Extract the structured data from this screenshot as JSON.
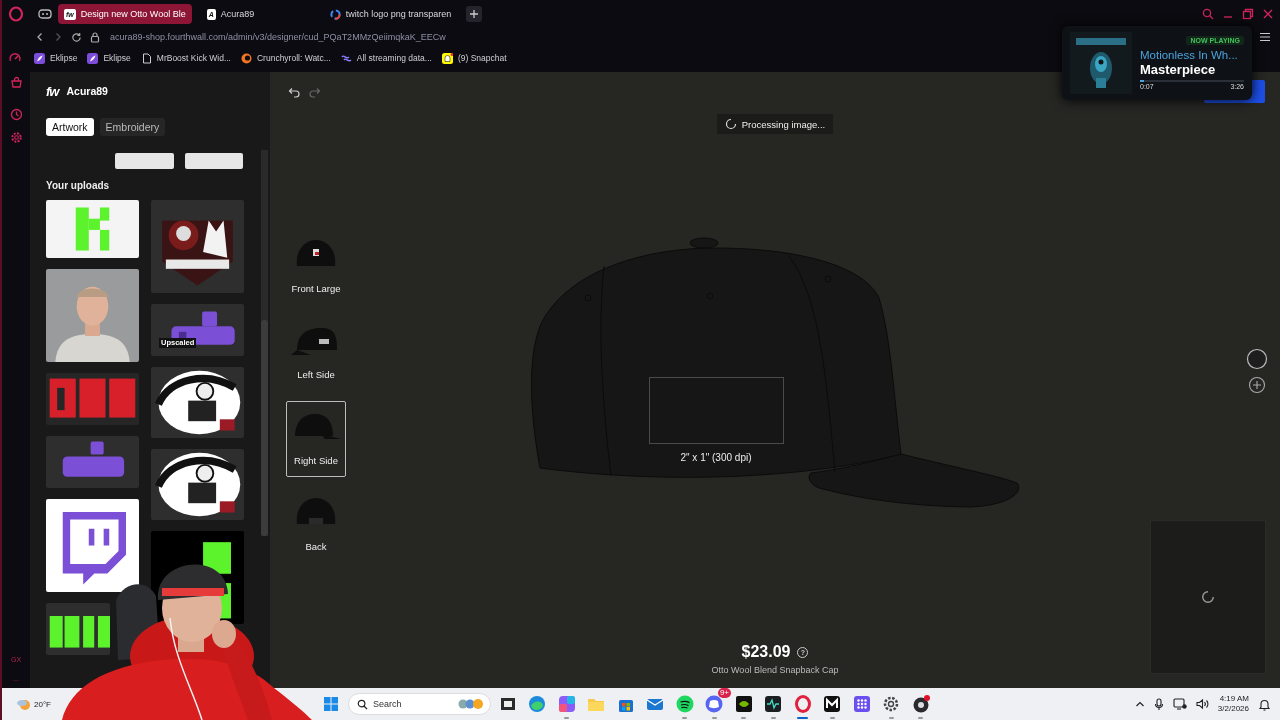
{
  "browser": {
    "tabs": [
      {
        "title": "Design new Otto Wool Ble",
        "selected": true,
        "kind": "letter",
        "favicon": "fw"
      },
      {
        "title": "Acura89",
        "selected": false,
        "kind": "letter",
        "favicon": "A"
      },
      {
        "title": "twitch logo png transparen",
        "selected": false,
        "kind": "ring"
      }
    ],
    "url": "acura89-shop.fourthwall.com/admin/v3/designer/cud_PQaT2MMzQeiimqkaK_EECw",
    "bookmarks": [
      {
        "label": "Eklipse",
        "kind": "feather"
      },
      {
        "label": "Eklipse",
        "kind": "feather"
      },
      {
        "label": "MrBoost Kick Wid...",
        "kind": "page"
      },
      {
        "label": "Crunchyroll: Watc...",
        "kind": "orange"
      },
      {
        "label": "All streaming data...",
        "kind": "swirl"
      },
      {
        "label": "(9) Snapchat",
        "kind": "ghost"
      }
    ],
    "sidebar_labels": [
      "GX",
      "..."
    ]
  },
  "now_playing": {
    "art": {
      "kind": "picture"
    },
    "badge": "NOW PLAYING",
    "artist": "Motionless In Wh...",
    "title": "Masterpiece",
    "elapsed": "0:07",
    "duration": "3:26",
    "level": 0.04
  },
  "designer": {
    "brand_mark": "fw",
    "shop": "Acura89",
    "tabs": [
      {
        "label": "Artwork",
        "selected": true
      },
      {
        "label": "Embroidery",
        "selected": false
      }
    ],
    "uploads_heading": "Your uploads",
    "uploads": [
      {
        "kind": "picture"
      },
      {
        "kind": "picture"
      },
      {
        "kind": "picture"
      },
      {
        "kind": "picture",
        "badge": "Upscaled"
      },
      {
        "kind": "picture"
      },
      {
        "kind": "picture"
      },
      {
        "kind": "picture"
      },
      {
        "kind": "picture"
      },
      {
        "kind": "picture"
      },
      {
        "kind": "picture"
      },
      {
        "kind": "picture"
      }
    ],
    "status": "Processing image...",
    "views": [
      {
        "label": "Front Large",
        "selected": false,
        "kind": "front"
      },
      {
        "label": "Left Side",
        "selected": false,
        "kind": "left"
      },
      {
        "label": "Right Side",
        "selected": true,
        "kind": "right"
      },
      {
        "label": "Back",
        "selected": false,
        "kind": "back"
      }
    ],
    "print_area": "2\" x 1\" (300 dpi)",
    "price": "$23.09",
    "price_help": "?",
    "product": "Otto Wool Blend Snapback Cap",
    "preview": {
      "loading": true
    }
  },
  "webcam": {
    "kind": "picture"
  },
  "taskbar": {
    "weather": "20°F",
    "search_placeholder": "Search",
    "apps": [
      {
        "kind": "taskview",
        "running": false,
        "selected": false
      },
      {
        "kind": "edge",
        "running": false,
        "selected": false
      },
      {
        "kind": "m365",
        "running": true,
        "selected": false
      },
      {
        "kind": "explorer",
        "running": false,
        "selected": false
      },
      {
        "kind": "store",
        "running": false,
        "selected": false
      },
      {
        "kind": "mail",
        "running": false,
        "selected": false
      },
      {
        "kind": "spotify",
        "running": true,
        "selected": false
      },
      {
        "kind": "discord",
        "running": true,
        "selected": false,
        "badge": "9+"
      },
      {
        "kind": "nvidia",
        "running": true,
        "selected": false
      },
      {
        "kind": "audio",
        "running": true,
        "selected": false
      },
      {
        "kind": "opera",
        "running": true,
        "selected": true
      },
      {
        "kind": "mark",
        "running": true,
        "selected": false
      },
      {
        "kind": "grid",
        "running": false,
        "selected": false
      },
      {
        "kind": "gear",
        "running": true,
        "selected": false
      },
      {
        "kind": "obs",
        "running": true,
        "selected": false
      }
    ],
    "time": "4:19 AM",
    "date": "3/2/2026"
  }
}
